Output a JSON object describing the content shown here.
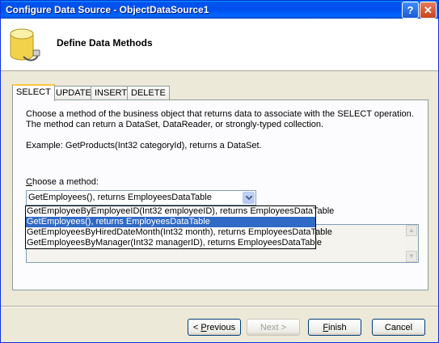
{
  "window": {
    "title": "Configure Data Source - ObjectDataSource1",
    "help_label": "?",
    "close_label": "✕"
  },
  "header": {
    "title": "Define Data Methods",
    "icon": "database-icon"
  },
  "tabs": [
    {
      "label": "SELECT",
      "active": true
    },
    {
      "label": "UPDATE",
      "active": false
    },
    {
      "label": "INSERT",
      "active": false
    },
    {
      "label": "DELETE",
      "active": false
    }
  ],
  "panel": {
    "description": "Choose a method of the business object that returns data to associate with the SELECT operation. The method can return a DataSet, DataReader, or strongly-typed collection.",
    "example": "Example: GetProducts(Int32 categoryId), returns a DataSet.",
    "choose_label_accel": "C",
    "choose_label_rest": "hoose a method:",
    "method_value": "GetEmployees(), returns EmployeesDataTable"
  },
  "dropdown": {
    "options": [
      "GetEmployeeByEmployeeID(Int32 employeeID), returns EmployeesDataTable",
      "GetEmployees(), returns EmployeesDataTable",
      "GetEmployeesByHiredDateMonth(Int32 month), returns EmployeesDataTable",
      "GetEmployeesByManager(Int32 managerID), returns EmployeesDataTable"
    ],
    "selected_index": 1
  },
  "buttons": {
    "previous_prefix": "< ",
    "previous_accel": "P",
    "previous_rest": "revious",
    "next": "Next >",
    "finish_accel": "F",
    "finish_rest": "inish",
    "cancel": "Cancel"
  },
  "colors": {
    "titlebar": "#0053ee",
    "selection": "#316ac5",
    "tab_highlight": "#ffc83c"
  }
}
